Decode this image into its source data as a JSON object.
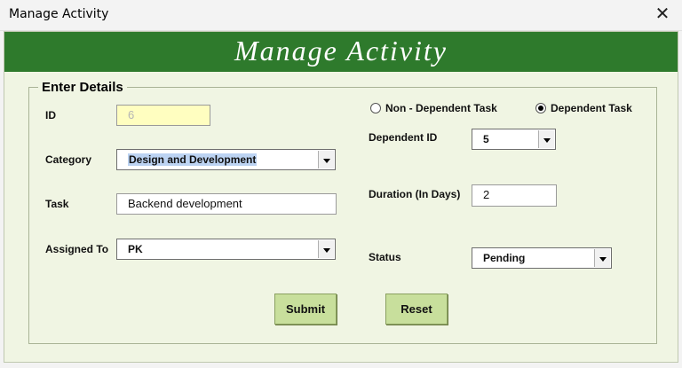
{
  "window": {
    "title": "Manage Activity",
    "close_glyph": "✕"
  },
  "banner": {
    "title": "Manage Activity"
  },
  "form": {
    "legend": "Enter Details",
    "id": {
      "label": "ID",
      "value": "6"
    },
    "category": {
      "label": "Category",
      "value": "Design and Development"
    },
    "task": {
      "label": "Task",
      "value": "Backend development"
    },
    "assigned_to": {
      "label": "Assigned To",
      "value": "PK"
    },
    "task_type": {
      "non_dependent_label": "Non - Dependent Task",
      "dependent_label": "Dependent Task",
      "selected": "Dependent Task"
    },
    "dependent_id": {
      "label": "Dependent ID",
      "value": "5"
    },
    "duration": {
      "label": "Duration (In Days)",
      "value": "2"
    },
    "status": {
      "label": "Status",
      "value": "Pending"
    },
    "submit_label": "Submit",
    "reset_label": "Reset"
  },
  "colors": {
    "banner": "#2e7a2c",
    "form_background": "#f0f5e3",
    "button": "#c8df9c",
    "disabled_field": "#fffec0",
    "selection": "#bcd3f2"
  }
}
